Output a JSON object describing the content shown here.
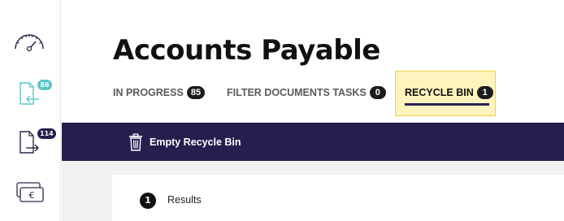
{
  "sidebar": {
    "items": [
      {
        "icon": "speedometer-icon"
      },
      {
        "icon": "document-incoming-icon",
        "badge": "86",
        "badge_color": "#5cc6c6"
      },
      {
        "icon": "document-outgoing-icon",
        "badge": "114",
        "badge_color": "#241f4d"
      },
      {
        "icon": "wallet-euro-icon"
      }
    ]
  },
  "page": {
    "title": "Accounts Payable"
  },
  "tabs": [
    {
      "label": "IN PROGRESS",
      "count": "85"
    },
    {
      "label": "FILTER DOCUMENTS TASKS",
      "count": "0"
    },
    {
      "label": "RECYCLE BIN",
      "count": "1",
      "active": true
    }
  ],
  "toolbar": {
    "empty_bin_label": "Empty Recycle Bin",
    "icon": "trash-icon"
  },
  "results": {
    "count": "1",
    "label": "Results"
  },
  "colors": {
    "toolbar_bg": "#241f4d",
    "active_tab_bg": "#fff4bd",
    "active_tab_border": "#f1d33a",
    "teal_accent": "#5cc6c6"
  }
}
